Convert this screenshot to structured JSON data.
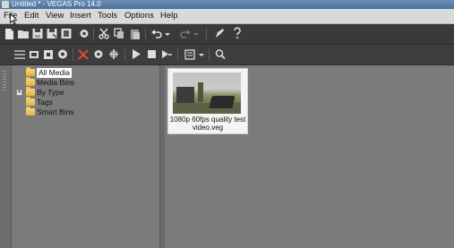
{
  "window": {
    "title": "Untitled * - VEGAS Pro 14.0"
  },
  "menu": [
    "File",
    "Edit",
    "View",
    "Insert",
    "Tools",
    "Options",
    "Help"
  ],
  "toolbar_main": [
    "new-icon",
    "open-icon",
    "save-icon",
    "save-as-icon",
    "render-icon",
    "properties-icon",
    "cut-icon",
    "copy-icon",
    "paste-icon",
    "undo-icon",
    "undo-dropdown-icon",
    "redo-icon",
    "redo-dropdown-icon",
    "edit-tool-icon",
    "help-icon"
  ],
  "toolbar_media": [
    "import-media-icon",
    "capture-icon",
    "get-media-icon",
    "web-icon",
    "remove-media-icon",
    "media-fx-icon",
    "media-generators-icon",
    "play-icon",
    "stop-icon",
    "auto-preview-icon",
    "views-icon",
    "views-dropdown-icon",
    "search-icon"
  ],
  "tree": {
    "nodes": [
      {
        "label": "All Media",
        "selected": true
      },
      {
        "label": "Media Bins",
        "selected": false
      },
      {
        "label": "By Type",
        "selected": false,
        "expandable": true
      },
      {
        "label": "Tags",
        "selected": false
      },
      {
        "label": "Smart Bins",
        "selected": false
      }
    ]
  },
  "media": {
    "items": [
      {
        "caption_line1": "1080p 60fps quality test",
        "caption_line2": "video.veg"
      }
    ]
  },
  "colors": {
    "titlebar": "#4a6f99",
    "menubar": "#d9d9d9",
    "toolbar": "#3a3a3a",
    "pane": "#7b7b7b",
    "folder": "#e2b23f"
  }
}
